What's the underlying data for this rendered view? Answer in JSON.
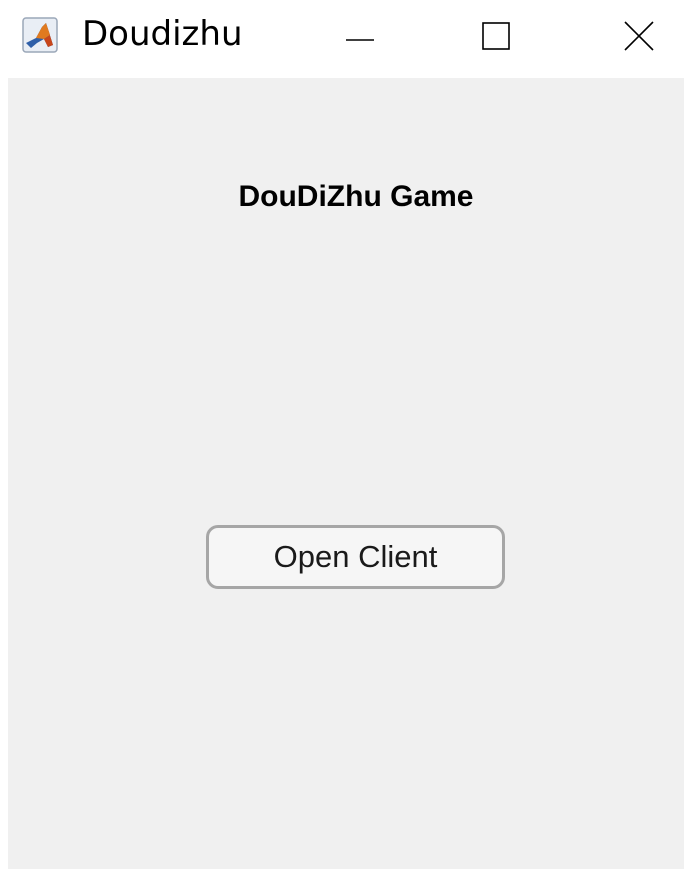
{
  "window": {
    "title": "Doudizhu",
    "app_icon": "matlab-logo-icon",
    "controls": {
      "minimize_icon": "minimize-icon",
      "maximize_icon": "maximize-icon",
      "close_icon": "close-icon"
    }
  },
  "main": {
    "heading": "DouDiZhu Game",
    "open_client_label": "Open Client"
  },
  "colors": {
    "background": "#f0f0f0",
    "titlebar": "#ffffff",
    "button_border": "#a6a6a6",
    "button_fill": "#f6f6f6"
  }
}
